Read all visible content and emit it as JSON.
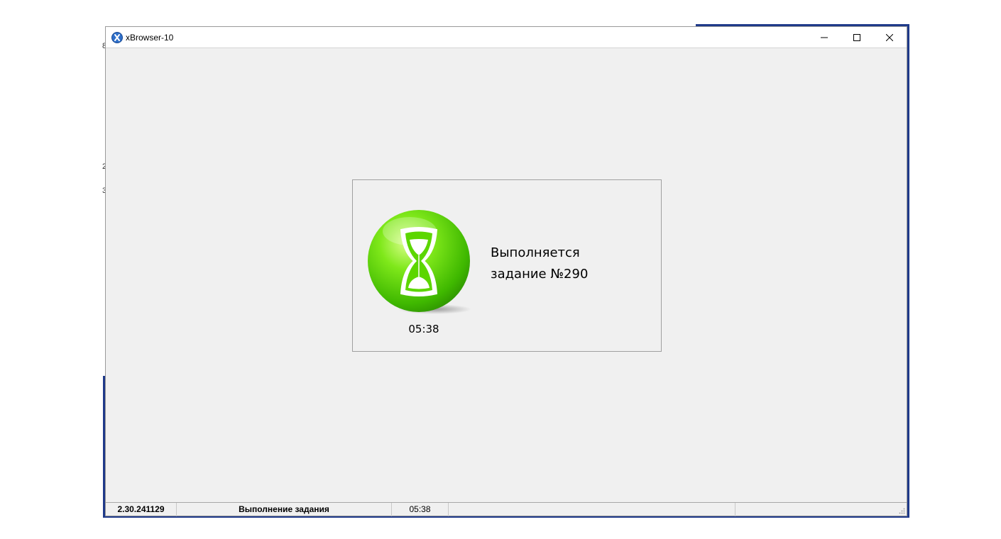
{
  "window": {
    "title": "xBrowser-10",
    "app_icon": "app-x-icon",
    "controls": {
      "minimize": "minimize-icon",
      "maximize": "maximize-icon",
      "close": "close-icon"
    }
  },
  "background": {
    "fragments": [
      "8",
      "2",
      "3"
    ]
  },
  "dialog": {
    "icon": "hourglass-icon",
    "timer": "05:38",
    "message_line1": "Выполняется",
    "message_line2": "задание №290"
  },
  "statusbar": {
    "version": "2.30.241129",
    "status": "Выполнение задания",
    "time": "05:38"
  },
  "colors": {
    "accent_green": "#5cd600",
    "window_bg": "#f0f0f0",
    "desktop_blue": "#1f3a8a"
  }
}
